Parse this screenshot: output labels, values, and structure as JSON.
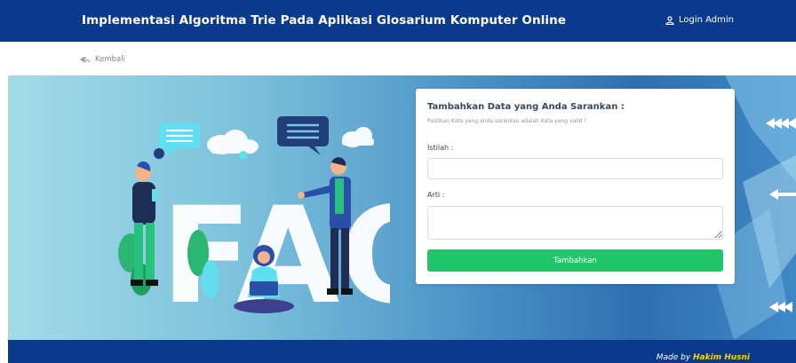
{
  "navbar": {
    "title": "Implementasi Algoritma Trie Pada Aplikasi Glosarium Komputer Online",
    "login_label": "Login Admin",
    "login_icon": "user-icon"
  },
  "back": {
    "label": "Kembali",
    "icon": "reply-arrow-icon"
  },
  "hero": {
    "illustration_text": "FAQ"
  },
  "form": {
    "heading": "Tambahkan Data yang Anda Sarankan :",
    "subtitle": "Pastikan Kata yang anda sarankan adalah Kata yang valid !",
    "istilah_label": "Istilah :",
    "istilah_value": "",
    "arti_label": "Arti :",
    "arti_value": "",
    "submit_label": "Tambahkan"
  },
  "footer": {
    "made_by_prefix": "Made by ",
    "author": "Hakim Husni"
  },
  "colors": {
    "navbar": "#0b3a8c",
    "button": "#20c76a",
    "author": "#ffd200"
  }
}
